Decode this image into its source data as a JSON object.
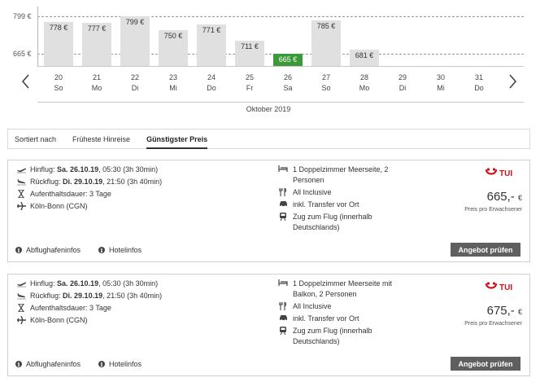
{
  "calendar": {
    "y_ticks": [
      "799 €",
      "665 €"
    ],
    "bars": [
      {
        "label": "778 €",
        "value": 778,
        "selected": false
      },
      {
        "label": "777 €",
        "value": 777,
        "selected": false
      },
      {
        "label": "799 €",
        "value": 799,
        "selected": false
      },
      {
        "label": "750 €",
        "value": 750,
        "selected": false
      },
      {
        "label": "771 €",
        "value": 771,
        "selected": false
      },
      {
        "label": "711 €",
        "value": 711,
        "selected": false
      },
      {
        "label": "665 €",
        "value": 665,
        "selected": true
      },
      {
        "label": "785 €",
        "value": 785,
        "selected": false
      },
      {
        "label": "681 €",
        "value": 681,
        "selected": false
      }
    ],
    "days": [
      {
        "num": "20",
        "wd": "So"
      },
      {
        "num": "21",
        "wd": "Mo"
      },
      {
        "num": "22",
        "wd": "Di"
      },
      {
        "num": "23",
        "wd": "Mi"
      },
      {
        "num": "24",
        "wd": "Do"
      },
      {
        "num": "25",
        "wd": "Fr"
      },
      {
        "num": "26",
        "wd": "Sa"
      },
      {
        "num": "27",
        "wd": "So"
      },
      {
        "num": "28",
        "wd": "Mo"
      },
      {
        "num": "29",
        "wd": "Di"
      },
      {
        "num": "30",
        "wd": "Mi"
      },
      {
        "num": "31",
        "wd": "Do"
      }
    ],
    "month": "Oktober 2019",
    "colors": {
      "bar": "#e0e0e0",
      "selected": "#3a9a3a"
    },
    "icons": {
      "prev": "chevron-left-icon",
      "next": "chevron-right-icon"
    }
  },
  "sort": {
    "label": "Sortiert nach",
    "options": [
      "Früheste Hinreise",
      "Günstigster Preis"
    ],
    "active": "Günstigster Preis"
  },
  "offers": [
    {
      "hinflug_label": "Hinflug:",
      "hinflug_date": "Sa. 26.10.19",
      "hinflug_rest": ", 05:30 (3h 30min)",
      "rueckflug_label": "Rückflug:",
      "rueckflug_date": "Di. 29.10.19",
      "rueckflug_rest": ", 21:50 (3h 40min)",
      "stay": "Aufenthaltsdauer: 3 Tage",
      "airport": "Köln-Bonn (CGN)",
      "room": [
        "1 Doppelzimmer Meerseite, 2",
        "Personen"
      ],
      "board": "All Inclusive",
      "transfer": "inkl. Transfer vor Ort",
      "train": [
        "Zug zum Flug (innerhalb",
        "Deutschlands)"
      ],
      "operator": "TUI",
      "price": "665,-",
      "currency": "€",
      "price_note": "Preis pro Erwachsener",
      "airport_info": "Abflughafeninfos",
      "hotel_info": "Hotelinfos",
      "cta": "Angebot prüfen"
    },
    {
      "hinflug_label": "Hinflug:",
      "hinflug_date": "Sa. 26.10.19",
      "hinflug_rest": ", 05:30 (3h 30min)",
      "rueckflug_label": "Rückflug:",
      "rueckflug_date": "Di. 29.10.19",
      "rueckflug_rest": ", 21:50 (3h 40min)",
      "stay": "Aufenthaltsdauer: 3 Tage",
      "airport": "Köln-Bonn (CGN)",
      "room": [
        "1 Doppelzimmer Meerseite mit",
        "Balkon, 2 Personen"
      ],
      "board": "All Inclusive",
      "transfer": "inkl. Transfer vor Ort",
      "train": [
        "Zug zum Flug (innerhalb",
        "Deutschlands)"
      ],
      "operator": "TUI",
      "price": "675,-",
      "currency": "€",
      "price_note": "Preis pro Erwachsener",
      "airport_info": "Abflughafeninfos",
      "hotel_info": "Hotelinfos",
      "cta": "Angebot prüfen"
    }
  ],
  "brand_colors": {
    "tui_red": "#d40e14",
    "button": "#5f5f5f"
  }
}
